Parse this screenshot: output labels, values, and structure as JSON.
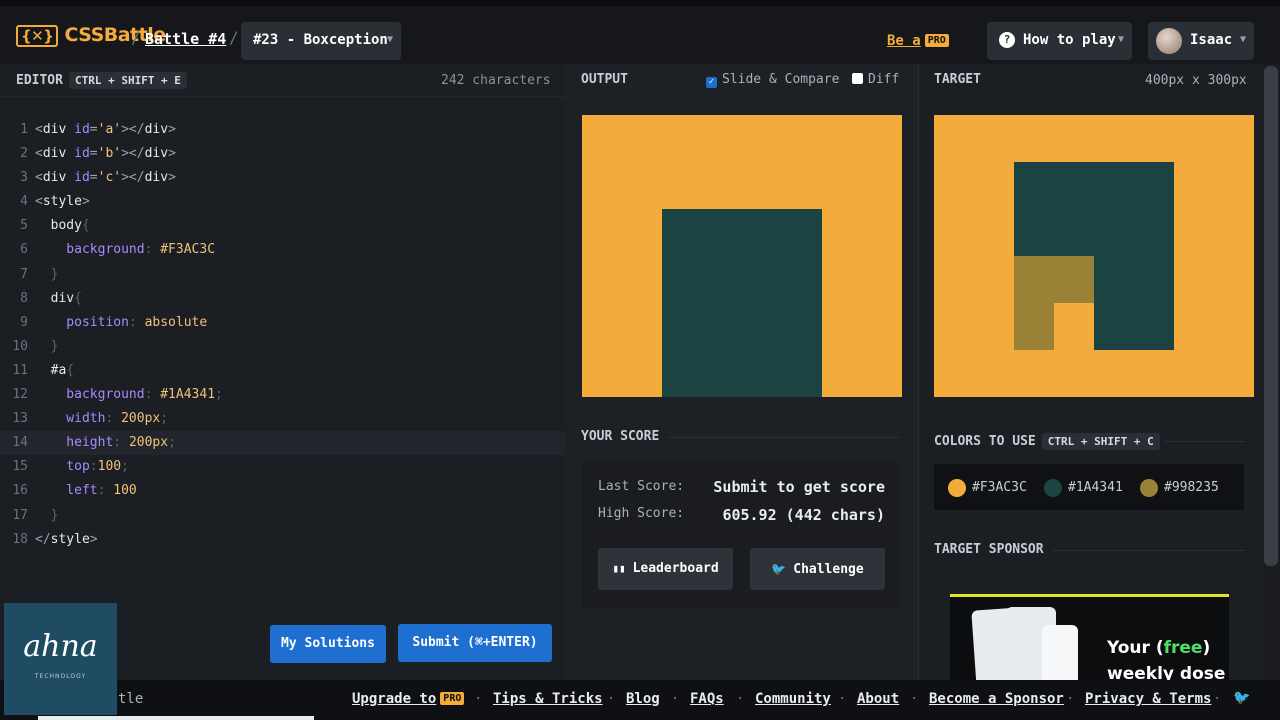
{
  "topbar": {
    "logo_mark": "{✕}",
    "logo_text": "CSSBattle",
    "sep": "/",
    "battle": "Battle #4",
    "level": "#23 - Boxception",
    "be_a": "Be a",
    "pro": "PRO",
    "how_to_play": "How to play",
    "user": "Isaac"
  },
  "editor": {
    "title": "EDITOR",
    "shortcut": "CTRL + SHIFT + E",
    "char_count": "242 characters",
    "lines": [
      {
        "n": "1",
        "segs": [
          [
            "t-tag",
            "<"
          ],
          [
            "t-name",
            "div "
          ],
          [
            "t-attr",
            "id"
          ],
          [
            "t-tag",
            "="
          ],
          [
            "t-str",
            "'a'"
          ],
          [
            "t-tag",
            "></"
          ],
          [
            "t-name",
            "div"
          ],
          [
            "t-tag",
            ">"
          ]
        ]
      },
      {
        "n": "2",
        "segs": [
          [
            "t-tag",
            "<"
          ],
          [
            "t-name",
            "div "
          ],
          [
            "t-attr",
            "id"
          ],
          [
            "t-tag",
            "="
          ],
          [
            "t-str",
            "'b'"
          ],
          [
            "t-tag",
            "></"
          ],
          [
            "t-name",
            "div"
          ],
          [
            "t-tag",
            ">"
          ]
        ]
      },
      {
        "n": "3",
        "segs": [
          [
            "t-tag",
            "<"
          ],
          [
            "t-name",
            "div "
          ],
          [
            "t-attr",
            "id"
          ],
          [
            "t-tag",
            "="
          ],
          [
            "t-str",
            "'c'"
          ],
          [
            "t-tag",
            "></"
          ],
          [
            "t-name",
            "div"
          ],
          [
            "t-tag",
            ">"
          ]
        ]
      },
      {
        "n": "4",
        "segs": [
          [
            "t-tag",
            "<"
          ],
          [
            "t-name",
            "style"
          ],
          [
            "t-tag",
            ">"
          ]
        ]
      },
      {
        "n": "5",
        "segs": [
          [
            "t-name",
            "  body"
          ],
          [
            "t-punc",
            "{"
          ]
        ]
      },
      {
        "n": "6",
        "segs": [
          [
            "t-prop",
            "    background"
          ],
          [
            "t-punc",
            ": "
          ],
          [
            "t-val",
            "#F3AC3C"
          ]
        ]
      },
      {
        "n": "7",
        "segs": [
          [
            "t-punc",
            "  }"
          ]
        ]
      },
      {
        "n": "8",
        "segs": [
          [
            "t-name",
            "  div"
          ],
          [
            "t-punc",
            "{"
          ]
        ]
      },
      {
        "n": "9",
        "segs": [
          [
            "t-prop",
            "    position"
          ],
          [
            "t-punc",
            ": "
          ],
          [
            "t-val",
            "absolute"
          ]
        ]
      },
      {
        "n": "10",
        "segs": [
          [
            "t-punc",
            "  }"
          ]
        ]
      },
      {
        "n": "11",
        "segs": [
          [
            "t-name",
            "  #a"
          ],
          [
            "t-punc",
            "{"
          ]
        ]
      },
      {
        "n": "12",
        "segs": [
          [
            "t-prop",
            "    background"
          ],
          [
            "t-punc",
            ": "
          ],
          [
            "t-val",
            "#1A4341"
          ],
          [
            "t-punc",
            ";"
          ]
        ]
      },
      {
        "n": "13",
        "segs": [
          [
            "t-prop",
            "    width"
          ],
          [
            "t-punc",
            ": "
          ],
          [
            "t-val",
            "200px"
          ],
          [
            "t-punc",
            ";"
          ]
        ]
      },
      {
        "n": "14",
        "segs": [
          [
            "t-prop",
            "    height"
          ],
          [
            "t-punc",
            ": "
          ],
          [
            "t-val",
            "200px"
          ],
          [
            "t-punc",
            ";"
          ]
        ]
      },
      {
        "n": "15",
        "segs": [
          [
            "t-prop",
            "    top"
          ],
          [
            "t-punc",
            ":"
          ],
          [
            "t-val",
            "100"
          ],
          [
            "t-punc",
            ";"
          ]
        ]
      },
      {
        "n": "16",
        "segs": [
          [
            "t-prop",
            "    left"
          ],
          [
            "t-punc",
            ": "
          ],
          [
            "t-val",
            "100"
          ]
        ]
      },
      {
        "n": "17",
        "segs": [
          [
            "t-punc",
            "  }"
          ]
        ]
      },
      {
        "n": "18",
        "segs": [
          [
            "t-tag",
            "</"
          ],
          [
            "t-name",
            "style"
          ],
          [
            "t-tag",
            ">"
          ]
        ]
      }
    ],
    "active_line": 14,
    "my_solutions": "My Solutions",
    "submit": "Submit (⌘+ENTER)"
  },
  "output": {
    "title": "OUTPUT",
    "slide_compare": "Slide & Compare",
    "slide_compare_checked": true,
    "diff": "Diff",
    "diff_checked": false
  },
  "target": {
    "title": "TARGET",
    "size": "400px x 300px"
  },
  "score": {
    "title": "YOUR SCORE",
    "last_label": "Last Score:",
    "last_value": "Submit to get score",
    "high_label": "High Score:",
    "high_value": "605.92 (442 chars)",
    "leaderboard": "Leaderboard",
    "challenge": "Challenge"
  },
  "colors": {
    "title": "COLORS TO USE",
    "shortcut": "CTRL + SHIFT + C",
    "items": [
      {
        "hex": "#F3AC3C",
        "color": "#f3ac3c"
      },
      {
        "hex": "#1A4341",
        "color": "#1a4341"
      },
      {
        "hex": "#998235",
        "color": "#998235"
      }
    ]
  },
  "sponsor": {
    "title": "TARGET SPONSOR",
    "line1_a": "Your (",
    "line1_free": "free",
    "line1_b": ")",
    "line2": "weekly dose"
  },
  "footer": {
    "left_text": "tle",
    "upgrade": "Upgrade to",
    "pro": "PRO",
    "tips": "Tips & Tricks",
    "blog": "Blog",
    "faqs": "FAQs",
    "community": "Community",
    "about": "About",
    "sponsor": "Become a Sponsor",
    "privacy": "Privacy & Terms"
  },
  "watermark": {
    "name": "ahna",
    "sub": "TECHNOLOGY"
  }
}
